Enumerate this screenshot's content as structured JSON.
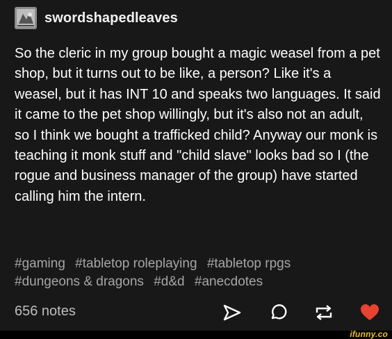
{
  "post": {
    "author": {
      "username": "swordshapedleaves",
      "avatar_icon": "avatar-image"
    },
    "body": "So the cleric in my group bought a magic weasel from a pet shop, but it turns out to be like, a person? Like it's a weasel, but it has INT 10 and speaks two languages. It said it came to the pet shop willingly, but it's also not an adult, so I think we bought a trafficked child? Anyway our monk is teaching it monk stuff and \"child slave\" looks bad so I (the rogue and business manager of the group) have started calling him the intern.",
    "tags": [
      "#gaming",
      "#tabletop roleplaying",
      "#tabletop rpgs",
      "#dungeons & dragons",
      "#d&d",
      "#anecdotes"
    ],
    "notes_label": "656 notes",
    "actions": [
      {
        "name": "share-icon"
      },
      {
        "name": "reply-icon"
      },
      {
        "name": "reblog-icon"
      },
      {
        "name": "like-heart-icon",
        "color": "#e8432f"
      }
    ]
  },
  "watermark": "ifunny.co",
  "colors": {
    "page_background": "#000000",
    "post_background": "#181818",
    "text": "#ffffff",
    "tags": "#a6a6a6",
    "like": "#e8432f",
    "watermark": "#f2c200"
  }
}
